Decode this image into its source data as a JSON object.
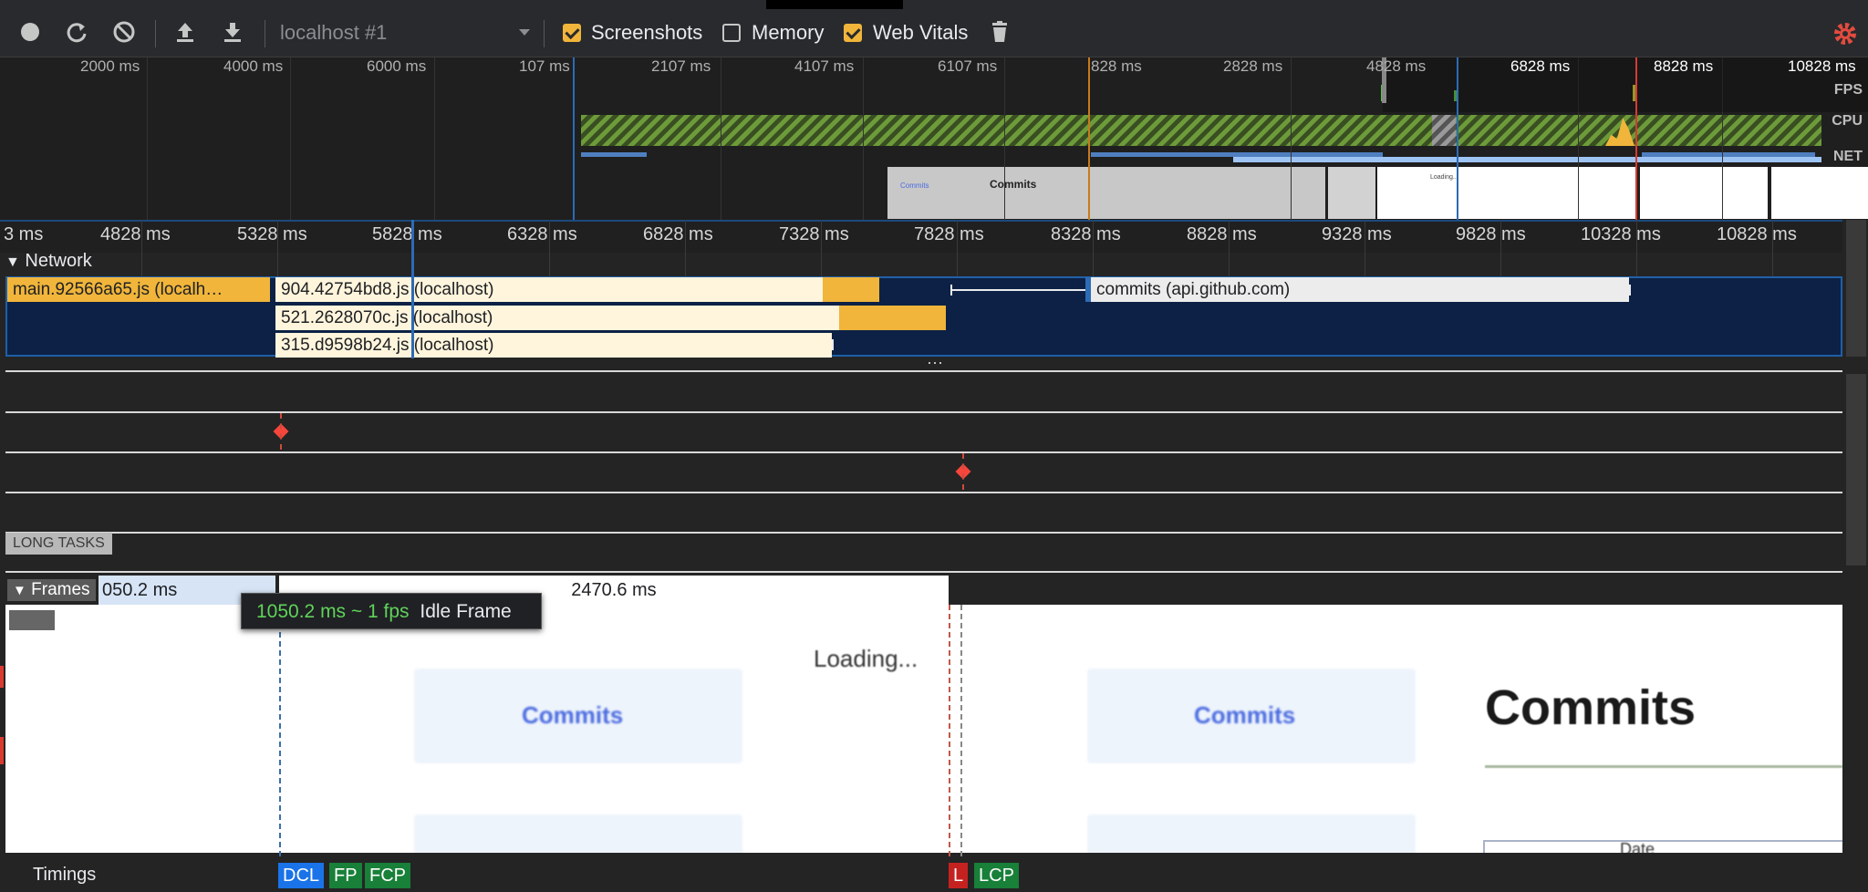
{
  "toolbar": {
    "target_select": "localhost #1",
    "options": [
      {
        "label": "Screenshots",
        "checked": true
      },
      {
        "label": "Memory",
        "checked": false
      },
      {
        "label": "Web Vitals",
        "checked": true
      }
    ],
    "icons": [
      "record-icon",
      "reload-icon",
      "clear-icon",
      "upload-icon",
      "download-icon",
      "dropdown-icon",
      "trash-icon",
      "settings-gear-icon"
    ],
    "accent": "#f0b53a",
    "gear_color": "#e34b3f"
  },
  "overview": {
    "ticks": [
      "2000 ms",
      "4000 ms",
      "6000 ms",
      "107 ms",
      "2107 ms",
      "4107 ms",
      "6107 ms",
      "828 ms",
      "2828 ms",
      "4828 ms",
      "6828 ms",
      "8828 ms",
      "10828 ms"
    ],
    "tracks": [
      "FPS",
      "CPU",
      "NET"
    ],
    "thumb_title": "Commits",
    "thumb_link": "Commits",
    "thumb_loading": "Loading..."
  },
  "ruler": {
    "ticks": [
      "3 ms",
      "4828 ms",
      "5328 ms",
      "5828 ms",
      "6328 ms",
      "6828 ms",
      "7328 ms",
      "7828 ms",
      "8328 ms",
      "8828 ms",
      "9328 ms",
      "9828 ms",
      "10328 ms",
      "10828 ms"
    ]
  },
  "network": {
    "header": "Network",
    "requests": [
      "main.92566a65.js (localh…",
      "904.42754bd8.js (localhost)",
      "521.2628070c.js (localhost)",
      "315.d9598b24.js (localhost)",
      "commits (api.github.com)"
    ],
    "more": "⋯"
  },
  "long_tasks": {
    "label": "LONG TASKS"
  },
  "frames": {
    "header": "Frames",
    "frame1": "050.2 ms",
    "frame2": "2470.6 ms",
    "tooltip_fps": "1050.2 ms ~ 1 fps",
    "tooltip_label": "Idle Frame"
  },
  "screenshots": {
    "loading": "Loading...",
    "link": "Commits",
    "heading": "Commits",
    "footer_text": "Date"
  },
  "timings": {
    "label": "Timings",
    "markers": [
      {
        "label": "DCL",
        "color": "#1a73e8"
      },
      {
        "label": "FP",
        "color": "#188038"
      },
      {
        "label": "FCP",
        "color": "#188038"
      },
      {
        "label": "L",
        "color": "#c5221f"
      },
      {
        "label": "LCP",
        "color": "#188038"
      }
    ]
  }
}
